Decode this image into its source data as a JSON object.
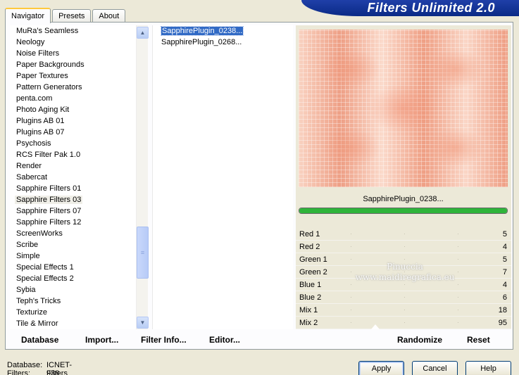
{
  "tabs": [
    {
      "label": "Navigator",
      "active": true
    },
    {
      "label": "Presets",
      "active": false
    },
    {
      "label": "About",
      "active": false
    }
  ],
  "banner": {
    "title": "Filters Unlimited 2.0"
  },
  "categories": [
    "MuRa's Seamless",
    "Neology",
    "Noise Filters",
    "Paper Backgrounds",
    "Paper Textures",
    "Pattern Generators",
    "penta.com",
    "Photo Aging Kit",
    "Plugins AB 01",
    "Plugins AB 07",
    "Psychosis",
    "RCS Filter Pak 1.0",
    "Render",
    "Sabercat",
    "Sapphire Filters 01",
    "Sapphire Filters 03",
    "Sapphire Filters 07",
    "Sapphire Filters 12",
    "ScreenWorks",
    "Scribe",
    "Simple",
    "Special Effects 1",
    "Special Effects 2",
    "Sybia",
    "Teph's Tricks",
    "Texturize",
    "Tile & Mirror"
  ],
  "selected_category": "Sapphire Filters 03",
  "filters": [
    {
      "label": "SapphirePlugin_0238...",
      "selected": true
    },
    {
      "label": "SapphirePlugin_0268...",
      "selected": false
    }
  ],
  "preview": {
    "filter_name": "SapphirePlugin_0238...",
    "progress": 1.0
  },
  "parameters": [
    {
      "name": "Red 1",
      "value": "5"
    },
    {
      "name": "Red 2",
      "value": "4"
    },
    {
      "name": "Green 1",
      "value": "5"
    },
    {
      "name": "Green 2",
      "value": "7"
    },
    {
      "name": "Blue 1",
      "value": "4"
    },
    {
      "name": "Blue 2",
      "value": "6"
    },
    {
      "name": "Mix 1",
      "value": "18"
    },
    {
      "name": "Mix 2",
      "value": "95"
    }
  ],
  "watermark": {
    "line1": "Pinuccia",
    "line2": "www.maidiregrafica.eu"
  },
  "toolbar": {
    "database": "Database",
    "import": "Import...",
    "filter_info": "Filter Info...",
    "editor": "Editor...",
    "randomize": "Randomize",
    "reset": "Reset"
  },
  "status": {
    "database_label": "Database:",
    "database_value": "ICNET-Filters",
    "filters_label": "Filters:",
    "filters_value": "938"
  },
  "buttons": {
    "apply": "Apply",
    "cancel": "Cancel",
    "help": "Help"
  },
  "colors": {
    "window_bg": "#ece9d8",
    "banner": "#0a2a86",
    "selection": "#316ac5",
    "progress": "#2fb43a",
    "preview_base": "#f2b49c"
  }
}
